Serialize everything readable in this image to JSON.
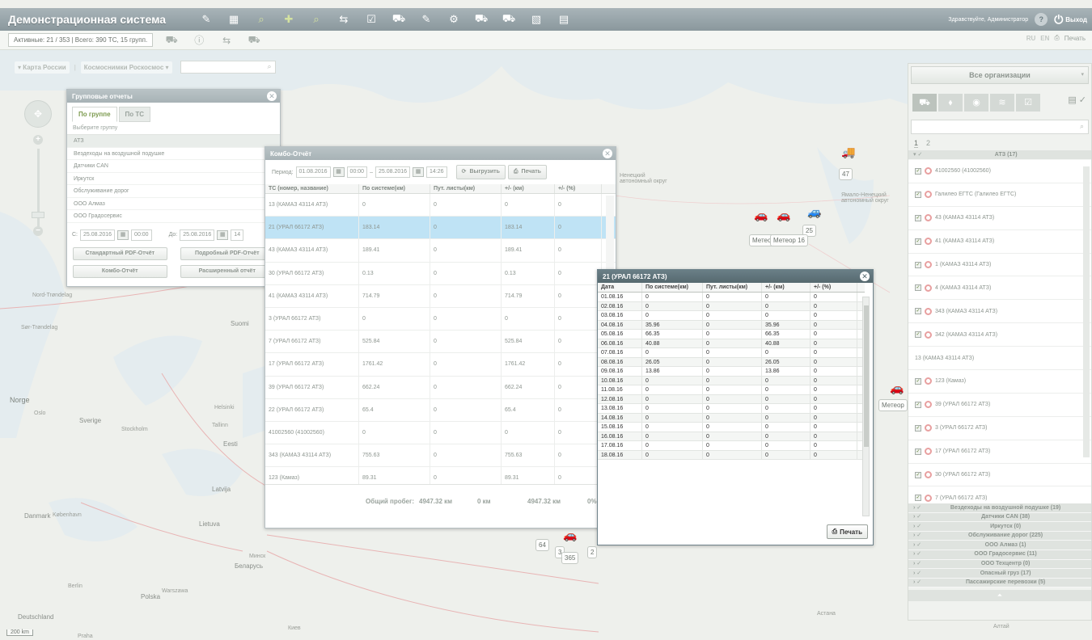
{
  "app": {
    "title": "Демонстрационная система",
    "greeting": "Здравствуйте, Администратор",
    "help": "?",
    "logout": "Выход"
  },
  "subbar": {
    "stats": "Активные: 21 / 353  |  Всего: 390 ТС, 15 групп.",
    "lang_ru": "RU",
    "lang_en": "EN",
    "print": "Печать"
  },
  "mapctl": {
    "map_russia": "Карта России",
    "satellite": "Космоснимки Роскосмос"
  },
  "scale": "200 km",
  "map_labels": {
    "suomi": "Suomi",
    "norge": "Norge",
    "sverige": "Sverige",
    "oslo": "Oslo",
    "stockholm": "Stockholm",
    "helsinki": "Helsinki",
    "tallinn": "Tallinn",
    "eesti": "Eesti",
    "latvija": "Latvija",
    "lietuva": "Lietuva",
    "danmark": "Danmark",
    "kobenhavn": "København",
    "berlin": "Berlin",
    "polska": "Polska",
    "warszawa": "Warszawa",
    "deutschland": "Deutschland",
    "belarus": "Беларусь",
    "minsk": "Минск",
    "kiev": "Киев",
    "astana": "Астана",
    "nenets": "Ненецкий автономный округ",
    "yamal": "Ямало-Ненецкий автономный округ",
    "nord_trondelag": "Nord-Trøndelag",
    "sor_trondelag": "Sør-Trøndelag",
    "praha": "Praha",
    "altai": "Алтай"
  },
  "markers": {
    "m47": "47",
    "m25": "25",
    "meteor1": "Метео",
    "meteor16": "Метеор 16",
    "meteor_r": "Метеор",
    "m64": "64",
    "m365": "365",
    "m3": "3",
    "m2": "2"
  },
  "group_reports": {
    "title": "Групповые отчеты",
    "tab_group": "По группе",
    "tab_vehicle": "По ТС",
    "hint": "Выберите группу",
    "groups": [
      "АТЗ",
      "Вездеходы на воздушной подушке",
      "Датчики CAN",
      "Иркутск",
      "Обслуживание дорог",
      "ООО Алмаз",
      "ООО Градосервис"
    ],
    "from_label": "С:",
    "from_date": "25.08.2016",
    "from_time": "00:00",
    "to_label": "До:",
    "to_date": "25.08.2016",
    "to_time": "14",
    "btn_std": "Стандартный PDF-Отчёт",
    "btn_detail": "Подробный PDF-Отчёт",
    "btn_combo": "Комбо-Отчёт",
    "btn_ext": "Расширенный отчёт"
  },
  "combo": {
    "title": "Комбо-Отчёт",
    "period_label": "Период:",
    "from_date": "01.08.2016",
    "from_time": "00:00",
    "dash": "–",
    "to_date": "25.08.2016",
    "to_time": "14:26",
    "export": "Выгрузить",
    "print": "Печать",
    "headers": [
      "ТС (номер, название)",
      "По системе(км)",
      "Пут. листы(км)",
      "+/- (км)",
      "+/- (%)"
    ],
    "rows": [
      [
        "13 (КАМАЗ 43114 АТЗ)",
        "0",
        "0",
        "0",
        "0"
      ],
      [
        "21 (УРАЛ 66172 АТЗ)",
        "183.14",
        "0",
        "183.14",
        "0"
      ],
      [
        "43 (КАМАЗ 43114 АТЗ)",
        "189.41",
        "0",
        "189.41",
        "0"
      ],
      [
        "30 (УРАЛ 66172 АТЗ)",
        "0.13",
        "0",
        "0.13",
        "0"
      ],
      [
        "41 (КАМАЗ 43114 АТЗ)",
        "714.79",
        "0",
        "714.79",
        "0"
      ],
      [
        "3 (УРАЛ 66172 АТЗ)",
        "0",
        "0",
        "0",
        "0"
      ],
      [
        "7 (УРАЛ 66172 АТЗ)",
        "525.84",
        "0",
        "525.84",
        "0"
      ],
      [
        "17 (УРАЛ 66172 АТЗ)",
        "1761.42",
        "0",
        "1761.42",
        "0"
      ],
      [
        "39 (УРАЛ 66172 АТЗ)",
        "662.24",
        "0",
        "662.24",
        "0"
      ],
      [
        "22 (УРАЛ 66172 АТЗ)",
        "65.4",
        "0",
        "65.4",
        "0"
      ],
      [
        "41002560 (41002560)",
        "0",
        "0",
        "0",
        "0"
      ],
      [
        "343 (КАМАЗ 43114 АТЗ)",
        "755.63",
        "0",
        "755.63",
        "0"
      ],
      [
        "123 (Камаз)",
        "89.31",
        "0",
        "89.31",
        "0"
      ]
    ],
    "total_label": "Общий пробег:",
    "total_sys": "4947.32 км",
    "total_wb": "0 км",
    "total_diff": "4947.32 км",
    "total_pct": "0%"
  },
  "vehicle": {
    "title": "21 (УРАЛ 66172 АТЗ)",
    "headers": [
      "Дата",
      "По системе(км)",
      "Пут. листы(км)",
      "+/- (км)",
      "+/- (%)"
    ],
    "rows": [
      [
        "01.08.16",
        "0",
        "0",
        "0",
        "0"
      ],
      [
        "02.08.16",
        "0",
        "0",
        "0",
        "0"
      ],
      [
        "03.08.16",
        "0",
        "0",
        "0",
        "0"
      ],
      [
        "04.08.16",
        "35.96",
        "0",
        "35.96",
        "0"
      ],
      [
        "05.08.16",
        "66.35",
        "0",
        "66.35",
        "0"
      ],
      [
        "06.08.16",
        "40.88",
        "0",
        "40.88",
        "0"
      ],
      [
        "07.08.16",
        "0",
        "0",
        "0",
        "0"
      ],
      [
        "08.08.16",
        "26.05",
        "0",
        "26.05",
        "0"
      ],
      [
        "09.08.16",
        "13.86",
        "0",
        "13.86",
        "0"
      ],
      [
        "10.08.16",
        "0",
        "0",
        "0",
        "0"
      ],
      [
        "11.08.16",
        "0",
        "0",
        "0",
        "0"
      ],
      [
        "12.08.16",
        "0",
        "0",
        "0",
        "0"
      ],
      [
        "13.08.16",
        "0",
        "0",
        "0",
        "0"
      ],
      [
        "14.08.16",
        "0",
        "0",
        "0",
        "0"
      ],
      [
        "15.08.16",
        "0",
        "0",
        "0",
        "0"
      ],
      [
        "16.08.16",
        "0",
        "0",
        "0",
        "0"
      ],
      [
        "17.08.16",
        "0",
        "0",
        "0",
        "0"
      ],
      [
        "18.08.16",
        "0",
        "0",
        "0",
        "0"
      ]
    ],
    "print": "Печать"
  },
  "right_panel": {
    "org": "Все организации",
    "page1": "1",
    "page2": "2",
    "group_name": "АТЗ (17)",
    "vehicles": [
      {
        "name": "41002560 (41002560)",
        "checked": true
      },
      {
        "name": "Галилео ЕГТС (Галилео ЕГТС)",
        "checked": true
      },
      {
        "name": "43 (КАМАЗ 43114 АТЗ)",
        "checked": true
      },
      {
        "name": "41 (КАМАЗ 43114 АТЗ)",
        "checked": true
      },
      {
        "name": "1 (КАМАЗ 43114 АТЗ)",
        "checked": true
      },
      {
        "name": "4 (КАМАЗ 43114 АТЗ)",
        "checked": true
      },
      {
        "name": "343 (КАМАЗ 43114 АТЗ)",
        "checked": true
      },
      {
        "name": "342 (КАМАЗ 43114 АТЗ)",
        "checked": true
      },
      {
        "name": "13 (КАМАЗ 43114 АТЗ)",
        "checked": false
      },
      {
        "name": "123 (Камаз)",
        "checked": true
      },
      {
        "name": "39 (УРАЛ 66172 АТЗ)",
        "checked": true
      },
      {
        "name": "3 (УРАЛ 66172 АТЗ)",
        "checked": true
      },
      {
        "name": "17 (УРАЛ 66172 АТЗ)",
        "checked": true
      },
      {
        "name": "30 (УРАЛ 66172 АТЗ)",
        "checked": true
      },
      {
        "name": "7 (УРАЛ 66172 АТЗ)",
        "checked": true
      }
    ],
    "other_groups": [
      "Вездеходы на воздушной подушке (19)",
      "Датчики CAN (38)",
      "Иркутск (0)",
      "Обслуживание дорог (225)",
      "ООО Алмаз (1)",
      "ООО Градосервис (11)",
      "ООО Техцентр (0)",
      "Опасный груз (17)",
      "Пассажирские перевозки (5)"
    ]
  }
}
